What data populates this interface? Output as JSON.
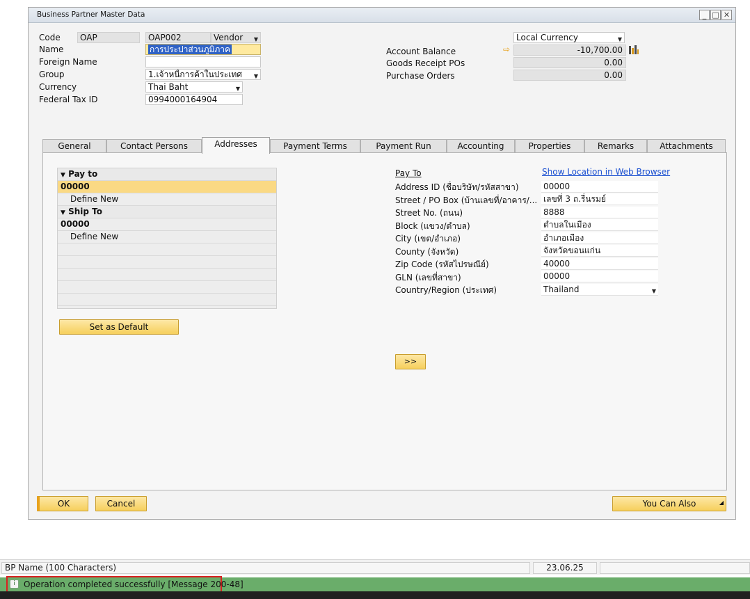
{
  "window": {
    "title": "Business Partner Master Data"
  },
  "header": {
    "code_label": "Code",
    "code_series": "OAP",
    "code_value": "OAP002",
    "bp_type": "Vendor",
    "name_label": "Name",
    "name_value": "การประปาส่วนภูมิภาค",
    "foreign_name_label": "Foreign Name",
    "foreign_name_value": "",
    "group_label": "Group",
    "group_value": "1.เจ้าหนี้การค้าในประเทศ",
    "currency_label": "Currency",
    "currency_value": "Thai Baht",
    "tax_id_label": "Federal Tax ID",
    "tax_id_value": "0994000164904"
  },
  "balances": {
    "currency_mode": "Local Currency",
    "account_balance_label": "Account Balance",
    "account_balance_value": "-10,700.00",
    "goods_receipt_label": "Goods Receipt POs",
    "goods_receipt_value": "0.00",
    "purchase_orders_label": "Purchase Orders",
    "purchase_orders_value": "0.00"
  },
  "tabs": [
    {
      "label": "General"
    },
    {
      "label": "Contact Persons"
    },
    {
      "label": "Addresses"
    },
    {
      "label": "Payment Terms"
    },
    {
      "label": "Payment Run"
    },
    {
      "label": "Accounting"
    },
    {
      "label": "Properties"
    },
    {
      "label": "Remarks"
    },
    {
      "label": "Attachments"
    }
  ],
  "active_tab": "Addresses",
  "addresses": {
    "pay_to_header": "Pay to",
    "pay_to_items": [
      "00000",
      "Define New"
    ],
    "ship_to_header": "Ship To",
    "ship_to_items": [
      "00000",
      "Define New"
    ],
    "set_default_label": "Set as Default"
  },
  "address_detail": {
    "title": "Pay To",
    "web_link": "Show Location in Web Browser",
    "fields": [
      {
        "label": "Address ID (ชื่อบริษัท/รหัสสาขา)",
        "value": "00000"
      },
      {
        "label": "Street / PO Box (บ้านเลขที่/อาคาร/...",
        "value": "เลขที่ 3 ถ.รื่นรมย์"
      },
      {
        "label": "Street No. (ถนน)",
        "value": "8888"
      },
      {
        "label": "Block (แขวง/ตำบล)",
        "value": "ตำบลในเมือง"
      },
      {
        "label": "City (เขต/อำเภอ)",
        "value": "อำเภอเมือง"
      },
      {
        "label": "County (จังหวัด)",
        "value": "จังหวัดขอนแก่น"
      },
      {
        "label": "Zip Code (รหัสไปรษณีย์)",
        "value": "40000"
      },
      {
        "label": "GLN (เลขที่สาขา)",
        "value": "00000"
      },
      {
        "label": "Country/Region (ประเทศ)",
        "value": "Thailand"
      }
    ],
    "expand_button": ">>"
  },
  "footer": {
    "ok_label": "OK",
    "cancel_label": "Cancel",
    "you_can_also_label": "You Can Also"
  },
  "statusbar": {
    "field_hint": "BP Name (100 Characters)",
    "date": "23.06.25",
    "message": "Operation completed successfully  [Message 200-48]"
  },
  "colors": {
    "accent_yellow": "#f6cf5c",
    "selection_yellow": "#fad984",
    "status_green": "#6aad6a",
    "link_blue": "#1a4fd1",
    "highlight_red": "#d92121"
  },
  "icons": [
    "info-icon",
    "dropdown-arrow-icon",
    "arrow-right-icon",
    "bar-chart-icon",
    "minimize-icon",
    "maximize-icon",
    "close-icon",
    "collapse-triangle-icon"
  ]
}
